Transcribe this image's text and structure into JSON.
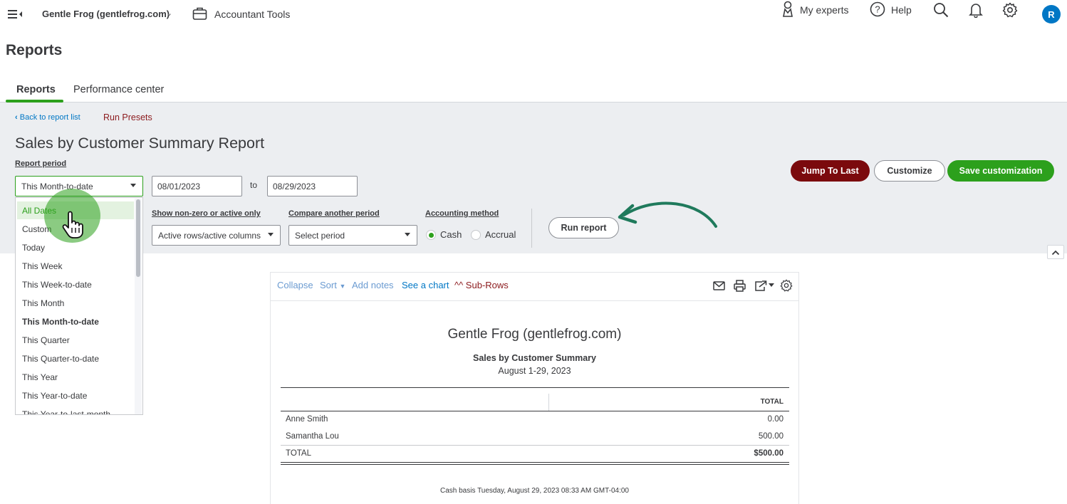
{
  "topbar": {
    "company": "Gentle Frog (gentlefrog.com)",
    "accountant_tools": "Accountant Tools",
    "my_experts": "My experts",
    "help": "Help",
    "avatar_initial": "R"
  },
  "page": {
    "title": "Reports"
  },
  "tabs": [
    {
      "label": "Reports",
      "active": true
    },
    {
      "label": "Performance center",
      "active": false
    }
  ],
  "settings": {
    "back_link": "Back to report list",
    "run_presets": "Run Presets",
    "report_title": "Sales by Customer Summary Report",
    "report_period_label": "Report period",
    "report_period_value": "This Month-to-date",
    "date_from": "08/01/2023",
    "to_label": "to",
    "date_to": "08/29/2023",
    "nonzero_label": "Show non-zero or active only",
    "nonzero_value": "Active rows/active columns",
    "compare_label": "Compare another period",
    "compare_placeholder": "Select period",
    "accounting_label": "Accounting method",
    "cash_label": "Cash",
    "accrual_label": "Accrual",
    "selected_method": "Cash",
    "run_report": "Run report",
    "jump_to_last": "Jump To Last",
    "customize": "Customize",
    "save_customization": "Save customization"
  },
  "period_dropdown": {
    "items": [
      "All Dates",
      "Custom",
      "Today",
      "This Week",
      "This Week-to-date",
      "This Month",
      "This Month-to-date",
      "This Quarter",
      "This Quarter-to-date",
      "This Year",
      "This Year-to-date",
      "This Year-to-last-month"
    ],
    "hovered": "All Dates",
    "selected": "This Month-to-date"
  },
  "report_toolbar": {
    "collapse": "Collapse",
    "sort": "Sort",
    "add_notes": "Add notes",
    "see_chart": "See a chart",
    "sub_rows": "^^ Sub-Rows"
  },
  "report": {
    "company": "Gentle Frog (gentlefrog.com)",
    "name": "Sales by Customer Summary",
    "date_range": "August 1-29, 2023",
    "column_header": "TOTAL",
    "rows": [
      {
        "customer": "Anne Smith",
        "total": "0.00"
      },
      {
        "customer": "Samantha Lou",
        "total": "500.00"
      }
    ],
    "total_label": "TOTAL",
    "total_value": "$500.00",
    "footer": "Cash basis  Tuesday, August 29, 2023  08:33 AM GMT-04:00"
  },
  "colors": {
    "green": "#2ca01c",
    "dark_red": "#7b0a0d",
    "link_blue": "#0077c5",
    "settings_bg": "#eceef1",
    "arrow": "#1f7a5c"
  }
}
